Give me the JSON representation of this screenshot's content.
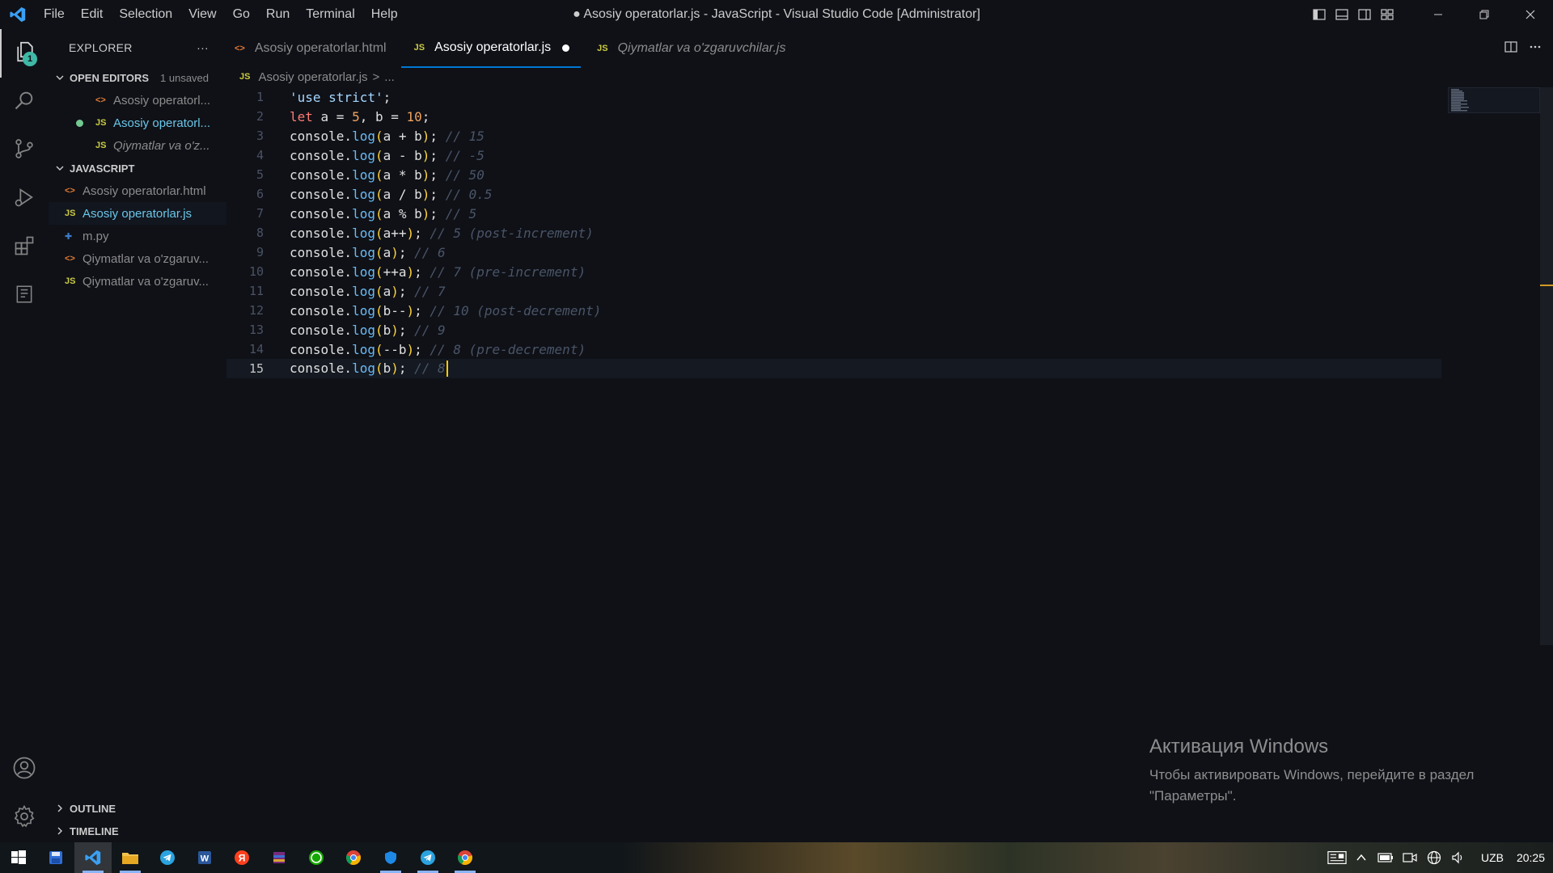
{
  "titlebar": {
    "menu": [
      "File",
      "Edit",
      "Selection",
      "View",
      "Go",
      "Run",
      "Terminal",
      "Help"
    ],
    "window_title": "● Asosiy operatorlar.js - JavaScript - Visual Studio Code [Administrator]"
  },
  "activity": {
    "explorer_badge": "1"
  },
  "sidebar": {
    "title": "EXPLORER",
    "more": "···",
    "open_editors": {
      "label": "OPEN EDITORS",
      "unsaved": "1 unsaved",
      "items": [
        {
          "icon": "<>",
          "label": "Asosiy operatorl..."
        },
        {
          "icon": "JS",
          "label": "Asosiy operatorl..."
        },
        {
          "icon": "JS",
          "label": "Qiymatlar va o'z..."
        }
      ]
    },
    "folder": {
      "label": "JAVASCRIPT",
      "items": [
        {
          "icon": "<>",
          "label": "Asosiy operatorlar.html"
        },
        {
          "icon": "JS",
          "label": "Asosiy operatorlar.js"
        },
        {
          "icon": "✚",
          "label": "m.py"
        },
        {
          "icon": "<>",
          "label": "Qiymatlar va o'zgaruv..."
        },
        {
          "icon": "JS",
          "label": "Qiymatlar va o'zgaruv..."
        }
      ]
    },
    "outline": "OUTLINE",
    "timeline": "TIMELINE"
  },
  "tabs": [
    {
      "icon": "<>",
      "label": "Asosiy operatorlar.html"
    },
    {
      "icon": "JS",
      "label": "Asosiy operatorlar.js"
    },
    {
      "icon": "JS",
      "label": "Qiymatlar va o'zgaruvchilar.js"
    }
  ],
  "breadcrumb": {
    "icon": "JS",
    "file": "Asosiy operatorlar.js",
    "sep": ">",
    "more": "..."
  },
  "editor": {
    "line_numbers": [
      "1",
      "2",
      "3",
      "4",
      "5",
      "6",
      "7",
      "8",
      "9",
      "10",
      "11",
      "12",
      "13",
      "14",
      "15"
    ],
    "lines": [
      {
        "pre": "'use strict'",
        "post": ";",
        "comment": ""
      },
      {
        "pre": "let a = 5, b = 10",
        "post": ";",
        "comment": ""
      },
      {
        "pre": "console.log(a + b)",
        "post": "; ",
        "comment": "// 15"
      },
      {
        "pre": "console.log(a - b)",
        "post": "; ",
        "comment": "// -5"
      },
      {
        "pre": "console.log(a * b)",
        "post": "; ",
        "comment": "// 50"
      },
      {
        "pre": "console.log(a / b)",
        "post": "; ",
        "comment": "// 0.5"
      },
      {
        "pre": "console.log(a % b)",
        "post": "; ",
        "comment": "// 5"
      },
      {
        "pre": "console.log(a++)",
        "post": "; ",
        "comment": "// 5 (post-increment)"
      },
      {
        "pre": "console.log(a)",
        "post": "; ",
        "comment": "// 6"
      },
      {
        "pre": "console.log(++a)",
        "post": "; ",
        "comment": "// 7 (pre-increment)"
      },
      {
        "pre": "console.log(a)",
        "post": "; ",
        "comment": "// 7"
      },
      {
        "pre": "console.log(b--)",
        "post": "; ",
        "comment": "// 10 (post-decrement)"
      },
      {
        "pre": "console.log(b)",
        "post": "; ",
        "comment": "// 9"
      },
      {
        "pre": "console.log(--b)",
        "post": "; ",
        "comment": "// 8 (pre-decrement)"
      },
      {
        "pre": "console.log(b)",
        "post": "; ",
        "comment": "// 8"
      }
    ]
  },
  "watermark": {
    "title": "Активация Windows",
    "text": "Чтобы активировать Windows, перейдите в раздел \"Параметры\"."
  },
  "taskbar": {
    "lang": "UZB",
    "time": "20:25"
  },
  "colors": {
    "accent": "#0078d4",
    "badge": "#3fb8a6",
    "modified": "#73c991",
    "js_icon": "#cbcb41",
    "html_icon": "#e37933",
    "py_icon": "#3d7cc9"
  }
}
